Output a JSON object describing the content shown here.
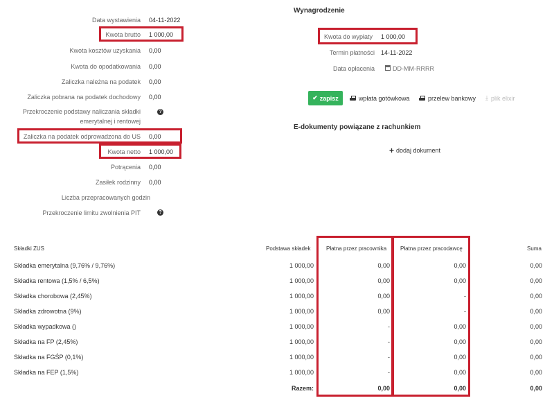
{
  "left_fields": [
    {
      "label": "Data wystawienia",
      "value": "04-11-2022",
      "highlight": false
    },
    {
      "label": "Kwota brutto",
      "value": "1 000,00",
      "highlight": true
    },
    {
      "label": "Kwota kosztów uzyskania",
      "value": "0,00",
      "highlight": false
    },
    {
      "label": "Kwota do opodatkowania",
      "value": "0,00",
      "highlight": false
    },
    {
      "label": "Zaliczka należna na podatek",
      "value": "0,00",
      "highlight": false
    },
    {
      "label": "Zaliczka pobrana na podatek dochodowy",
      "value": "0,00",
      "highlight": false
    },
    {
      "label_line1": "Przekroczenie podstawy naliczania składki",
      "label_line2": "emerytalnej i rentowej",
      "value": "",
      "help": true
    },
    {
      "label": "Zaliczka na podatek odprowadzona do US",
      "value": "0,00",
      "highlight": true
    },
    {
      "label": "Kwota netto",
      "value": "1 000,00",
      "highlight": true
    },
    {
      "label": "Potrącenia",
      "value": "0,00",
      "highlight": false
    },
    {
      "label": "Zasiłek rodzinny",
      "value": "0,00",
      "highlight": false
    },
    {
      "label": "Liczba przepracowanych godzin",
      "value": "",
      "highlight": false
    },
    {
      "label": "Przekroczenie limitu zwolnienia PIT",
      "value": "",
      "help": true
    }
  ],
  "payment": {
    "title": "Wynagrodzenie",
    "amount_label": "Kwota do wypłaty",
    "amount_value": "1 000,00",
    "due_label": "Termin płatności",
    "due_value": "14-11-2022",
    "paid_label": "Data opłacenia",
    "paid_placeholder": "DD-MM-RRRR"
  },
  "actions": {
    "save": "zapisz",
    "cash": "wpłata gotówkowa",
    "transfer": "przelew bankowy",
    "elixir": "plik elixir"
  },
  "edocs": {
    "title": "E-dokumenty powiązane z rachunkiem",
    "add": "dodaj dokument"
  },
  "zus": {
    "headers": {
      "name": "Składki ZUS",
      "base": "Podstawa składek",
      "employee": "Płatna przez pracownika",
      "employer": "Płatna przez pracodawcę",
      "sum": "Suma"
    },
    "rows": [
      {
        "name": "Składka emerytalna (9,76% / 9,76%)",
        "base": "1 000,00",
        "employee": "0,00",
        "employer": "0,00",
        "sum": "0,00"
      },
      {
        "name": "Składka rentowa (1,5% / 6,5%)",
        "base": "1 000,00",
        "employee": "0,00",
        "employer": "0,00",
        "sum": "0,00"
      },
      {
        "name": "Składka chorobowa (2,45%)",
        "base": "1 000,00",
        "employee": "0,00",
        "employer": "-",
        "sum": "0,00"
      },
      {
        "name": "Składka zdrowotna (9%)",
        "base": "1 000,00",
        "employee": "0,00",
        "employer": "-",
        "sum": "0,00"
      },
      {
        "name": "Składka wypadkowa ()",
        "base": "1 000,00",
        "employee": "-",
        "employer": "0,00",
        "sum": "0,00"
      },
      {
        "name": "Składka na FP (2,45%)",
        "base": "1 000,00",
        "employee": "-",
        "employer": "0,00",
        "sum": "0,00"
      },
      {
        "name": "Składka na FGŚP (0,1%)",
        "base": "1 000,00",
        "employee": "-",
        "employer": "0,00",
        "sum": "0,00"
      },
      {
        "name": "Składka na FEP (1,5%)",
        "base": "1 000,00",
        "employee": "-",
        "employer": "0,00",
        "sum": "0,00"
      }
    ],
    "total": {
      "label": "Razem:",
      "employee": "0,00",
      "employer": "0,00",
      "sum": "0,00"
    }
  },
  "colors": {
    "highlight": "#c8202f",
    "save": "#35b35c"
  }
}
